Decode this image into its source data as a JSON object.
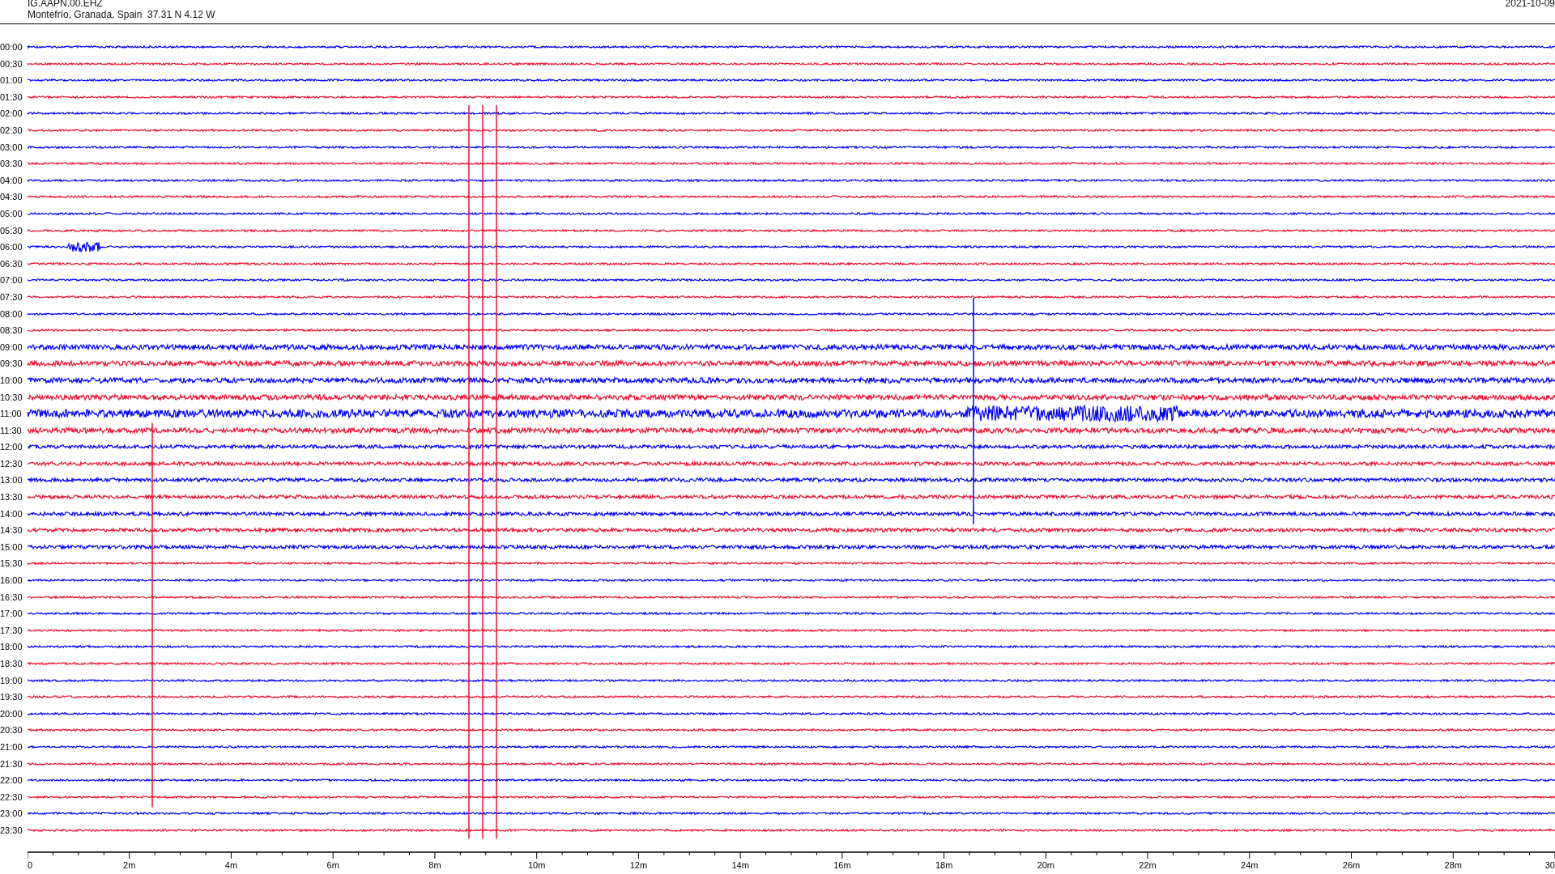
{
  "header": {
    "station": "IG.AAPN.00.EHZ",
    "location": "Montefrío, Granada, Spain  37.31 N 4.12 W",
    "date": "2021-10-09"
  },
  "rows": [
    {
      "time": "00:00",
      "color": "#0000ff"
    },
    {
      "time": "00:30",
      "color": "#ee1133"
    },
    {
      "time": "01:00",
      "color": "#0000ff"
    },
    {
      "time": "01:30",
      "color": "#ee1133"
    },
    {
      "time": "02:00",
      "color": "#0000ff"
    },
    {
      "time": "02:30",
      "color": "#ee1133"
    },
    {
      "time": "03:00",
      "color": "#0000ff"
    },
    {
      "time": "03:30",
      "color": "#ee1133"
    },
    {
      "time": "04:00",
      "color": "#0000ff"
    },
    {
      "time": "04:30",
      "color": "#ee1133"
    },
    {
      "time": "05:00",
      "color": "#0000ff"
    },
    {
      "time": "05:30",
      "color": "#ee1133"
    },
    {
      "time": "06:00",
      "color": "#0000ff"
    },
    {
      "time": "06:30",
      "color": "#ee1133"
    },
    {
      "time": "07:00",
      "color": "#0000ff"
    },
    {
      "time": "07:30",
      "color": "#ee1133"
    },
    {
      "time": "08:00",
      "color": "#0000ff"
    },
    {
      "time": "08:30",
      "color": "#ee1133"
    },
    {
      "time": "09:00",
      "color": "#0000ff"
    },
    {
      "time": "09:30",
      "color": "#ee1133"
    },
    {
      "time": "10:00",
      "color": "#0000ff"
    },
    {
      "time": "10:30",
      "color": "#ee1133"
    },
    {
      "time": "11:00",
      "color": "#0000ff"
    },
    {
      "time": "11:30",
      "color": "#ee1133"
    },
    {
      "time": "12:00",
      "color": "#0000ff"
    },
    {
      "time": "12:30",
      "color": "#ee1133"
    },
    {
      "time": "13:00",
      "color": "#0000ff"
    },
    {
      "time": "13:30",
      "color": "#ee1133"
    },
    {
      "time": "14:00",
      "color": "#0000ff"
    },
    {
      "time": "14:30",
      "color": "#ee1133"
    },
    {
      "time": "15:00",
      "color": "#0000ff"
    },
    {
      "time": "15:30",
      "color": "#ee1133"
    },
    {
      "time": "16:00",
      "color": "#0000ff"
    },
    {
      "time": "16:30",
      "color": "#ee1133"
    },
    {
      "time": "17:00",
      "color": "#0000ff"
    },
    {
      "time": "17:30",
      "color": "#ee1133"
    },
    {
      "time": "18:00",
      "color": "#0000ff"
    },
    {
      "time": "18:30",
      "color": "#ee1133"
    },
    {
      "time": "19:00",
      "color": "#0000ff"
    },
    {
      "time": "19:30",
      "color": "#ee1133"
    },
    {
      "time": "20:00",
      "color": "#0000ff"
    },
    {
      "time": "20:30",
      "color": "#ee1133"
    },
    {
      "time": "21:00",
      "color": "#0000ff"
    },
    {
      "time": "21:30",
      "color": "#ee1133"
    },
    {
      "time": "22:00",
      "color": "#0000ff"
    },
    {
      "time": "22:30",
      "color": "#ee1133"
    },
    {
      "time": "23:00",
      "color": "#0000ff"
    },
    {
      "time": "23:30",
      "color": "#ee1133"
    }
  ],
  "x_axis": {
    "labels": [
      "0",
      "2m",
      "4m",
      "6m",
      "8m",
      "10m",
      "12m",
      "14m",
      "16m",
      "18m",
      "20m",
      "22m",
      "24m",
      "26m",
      "28m",
      "30"
    ]
  }
}
